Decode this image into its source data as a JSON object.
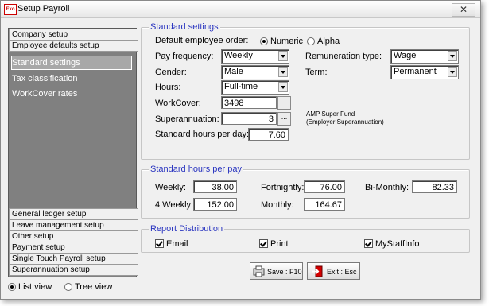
{
  "window": {
    "title": "Setup Payroll",
    "icon_text": "Exo"
  },
  "sidebar": {
    "headers_top": [
      "Company setup",
      "Employee defaults setup"
    ],
    "sub_items": [
      "Standard settings",
      "Tax classification",
      "WorkCover rates"
    ],
    "selected": "Standard settings",
    "headers_bottom": [
      "General ledger setup",
      "Leave management setup",
      "Other setup",
      "Payment setup",
      "Single Touch Payroll setup",
      "Superannuation setup"
    ]
  },
  "view_mode": {
    "list_label": "List view",
    "tree_label": "Tree view",
    "selected": "List view"
  },
  "standard_settings": {
    "title": "Standard settings",
    "default_order_label": "Default employee order:",
    "order_numeric": "Numeric",
    "order_alpha": "Alpha",
    "order_selected": "Numeric",
    "pay_frequency_label": "Pay frequency:",
    "pay_frequency_value": "Weekly",
    "gender_label": "Gender:",
    "gender_value": "Male",
    "hours_label": "Hours:",
    "hours_value": "Full-time",
    "workcover_label": "WorkCover:",
    "workcover_value": "3498",
    "superannuation_label": "Superannuation:",
    "superannuation_value": "3",
    "super_fund_name": "AMP Super Fund",
    "super_fund_type": "(Employer Superannuation)",
    "std_hours_day_label": "Standard hours per day:",
    "std_hours_day_value": "7.60",
    "remuneration_label": "Remuneration type:",
    "remuneration_value": "Wage",
    "term_label": "Term:",
    "term_value": "Permanent"
  },
  "hours_per_pay": {
    "title": "Standard hours per pay",
    "weekly_label": "Weekly:",
    "weekly_value": "38.00",
    "fortnightly_label": "Fortnightly:",
    "fortnightly_value": "76.00",
    "bimonthly_label": "Bi-Monthly:",
    "bimonthly_value": "82.33",
    "four_weekly_label": "4 Weekly:",
    "four_weekly_value": "152.00",
    "monthly_label": "Monthly:",
    "monthly_value": "164.67"
  },
  "report_distribution": {
    "title": "Report Distribution",
    "email_label": "Email",
    "email_checked": true,
    "print_label": "Print",
    "print_checked": true,
    "mystaffinfo_label": "MyStaffInfo",
    "mystaffinfo_checked": true
  },
  "buttons": {
    "save_label": "Save : F10",
    "exit_label": "Exit : Esc"
  }
}
